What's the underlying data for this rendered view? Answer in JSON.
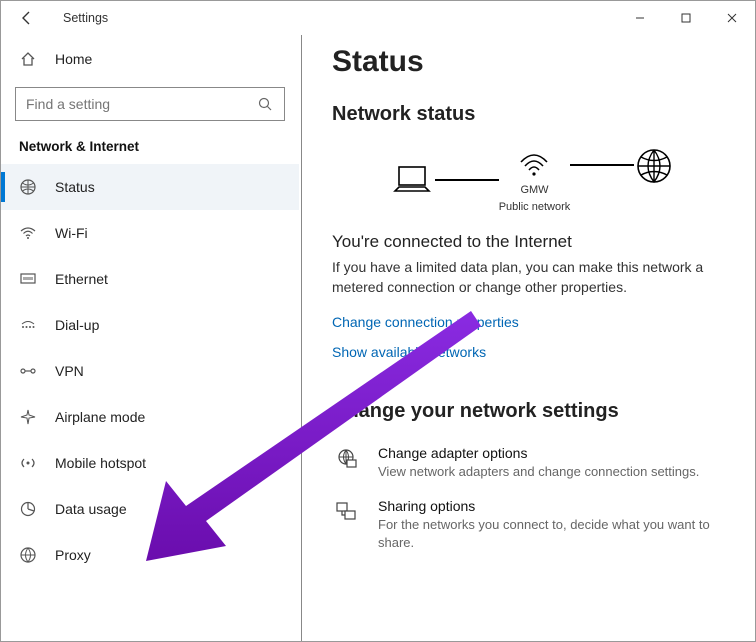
{
  "window": {
    "title": "Settings"
  },
  "sidebar": {
    "home": "Home",
    "search_placeholder": "Find a setting",
    "category": "Network & Internet",
    "items": [
      {
        "label": "Status"
      },
      {
        "label": "Wi-Fi"
      },
      {
        "label": "Ethernet"
      },
      {
        "label": "Dial-up"
      },
      {
        "label": "VPN"
      },
      {
        "label": "Airplane mode"
      },
      {
        "label": "Mobile hotspot"
      },
      {
        "label": "Data usage"
      },
      {
        "label": "Proxy"
      }
    ]
  },
  "main": {
    "title": "Status",
    "net_status_heading": "Network status",
    "diagram": {
      "ssid": "GMW",
      "net_type": "Public network"
    },
    "connected_heading": "You're connected to the Internet",
    "connected_body": "If you have a limited data plan, you can make this network a metered connection or change other properties.",
    "link_properties": "Change connection properties",
    "link_available": "Show available networks",
    "change_heading": "Change your network settings",
    "adapter": {
      "label": "Change adapter options",
      "desc": "View network adapters and change connection settings."
    },
    "sharing": {
      "label": "Sharing options",
      "desc": "For the networks you connect to, decide what you want to share."
    }
  }
}
